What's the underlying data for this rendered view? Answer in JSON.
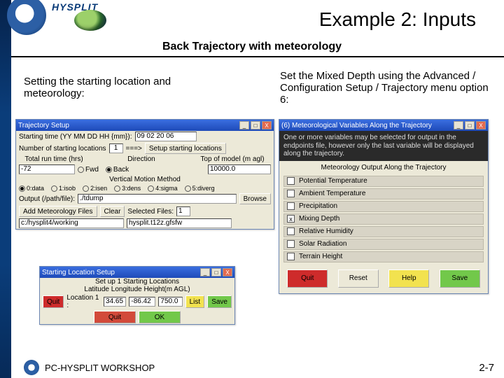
{
  "header": {
    "app": "HYSPLIT",
    "title": "Example 2: Inputs",
    "subtitle": "Back Trajectory with meteorology"
  },
  "left_text": "Setting the starting location and meteorology:",
  "right_text": "Set the Mixed Depth using the Advanced / Configuration Setup / Trajectory menu option 6:",
  "traj_win": {
    "title": "Trajectory Setup",
    "start_time_label": "Starting time (YY MM DD HH {mm}):",
    "start_time_value": "09 02 20 06",
    "num_loc_label": "Number of starting locations",
    "num_loc_value": "1",
    "arrow": "===>",
    "setup_btn": "Setup starting locations",
    "runtime_label": "Total run time (hrs)",
    "direction_label": "Direction",
    "top_model_label": "Top of model (m agl)",
    "runtime_value": "-72",
    "dir_fwd": "Fwd",
    "dir_back": "Back",
    "top_model_value": "10000.0",
    "vmm_label": "Vertical Motion Method",
    "vmm_opts": [
      "0:data",
      "1:isob",
      "2:isen",
      "3:dens",
      "4:sigma",
      "5:diverg"
    ],
    "output_label": "Output (/path/file):",
    "output_value": "./tdump",
    "browse": "Browse",
    "add_met": "Add Meteorology Files",
    "clear": "Clear",
    "sel_label": "Selected Files:",
    "sel_value": "1",
    "working_dir": "c:/hysplit4/working",
    "met_file": "hysplit.t12z.gfsfw"
  },
  "loc_win": {
    "title": "Starting Location Setup",
    "header": "Set up 1 Starting Locations",
    "cols": "Latitude Longitude Height(m AGL)",
    "quit": "Quit",
    "row_label": "Location 1 :",
    "lat": "34.65",
    "lon": "-86.42",
    "hgt": "750.0",
    "list": "List",
    "save": "Save",
    "quit2": "Quit",
    "ok": "OK"
  },
  "met_win": {
    "title": "(6) Meteorological Variables Along the Trajectory",
    "msg": "One or more variables may be selected for output in the endpoints file, however only the last variable will be displayed along the trajectory.",
    "section": "Meteorology Output Along the Trajectory",
    "items": [
      {
        "label": "Potential Temperature",
        "checked": false
      },
      {
        "label": "Ambient Temperature",
        "checked": false
      },
      {
        "label": "Precipitation",
        "checked": false
      },
      {
        "label": "Mixing Depth",
        "checked": true
      },
      {
        "label": "Relative Humidity",
        "checked": false
      },
      {
        "label": "Solar Radiation",
        "checked": false
      },
      {
        "label": "Terrain Height",
        "checked": false
      }
    ],
    "quit": "Quit",
    "reset": "Reset",
    "help": "Help",
    "save": "Save"
  },
  "footer": {
    "workshop": "PC-HYSPLIT WORKSHOP",
    "page": "2-7"
  }
}
